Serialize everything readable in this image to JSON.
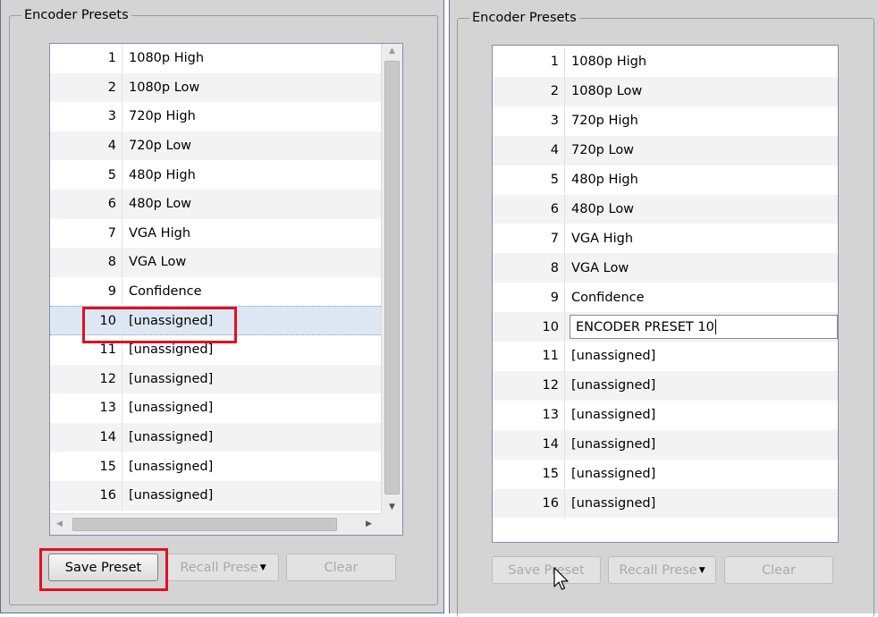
{
  "left": {
    "group_title": "Encoder Presets",
    "rows": [
      {
        "num": "1",
        "name": "1080p High"
      },
      {
        "num": "2",
        "name": "1080p Low"
      },
      {
        "num": "3",
        "name": "720p High"
      },
      {
        "num": "4",
        "name": "720p Low"
      },
      {
        "num": "5",
        "name": "480p High"
      },
      {
        "num": "6",
        "name": "480p Low"
      },
      {
        "num": "7",
        "name": "VGA High"
      },
      {
        "num": "8",
        "name": "VGA Low"
      },
      {
        "num": "9",
        "name": "Confidence"
      },
      {
        "num": "10",
        "name": "[unassigned]"
      },
      {
        "num": "11",
        "name": "[unassigned]"
      },
      {
        "num": "12",
        "name": "[unassigned]"
      },
      {
        "num": "13",
        "name": "[unassigned]"
      },
      {
        "num": "14",
        "name": "[unassigned]"
      },
      {
        "num": "15",
        "name": "[unassigned]"
      },
      {
        "num": "16",
        "name": "[unassigned]"
      }
    ],
    "selected_index": 9,
    "buttons": {
      "save": "Save Preset",
      "recall": "Recall Prese",
      "clear": "Clear"
    }
  },
  "right": {
    "group_title": "Encoder Presets",
    "rows": [
      {
        "num": "1",
        "name": "1080p High"
      },
      {
        "num": "2",
        "name": "1080p Low"
      },
      {
        "num": "3",
        "name": "720p High"
      },
      {
        "num": "4",
        "name": "720p Low"
      },
      {
        "num": "5",
        "name": "480p High"
      },
      {
        "num": "6",
        "name": "480p Low"
      },
      {
        "num": "7",
        "name": "VGA High"
      },
      {
        "num": "8",
        "name": "VGA Low"
      },
      {
        "num": "9",
        "name": "Confidence"
      },
      {
        "num": "10",
        "name": "ENCODER PRESET 10"
      },
      {
        "num": "11",
        "name": "[unassigned]"
      },
      {
        "num": "12",
        "name": "[unassigned]"
      },
      {
        "num": "13",
        "name": "[unassigned]"
      },
      {
        "num": "14",
        "name": "[unassigned]"
      },
      {
        "num": "15",
        "name": "[unassigned]"
      },
      {
        "num": "16",
        "name": "[unassigned]"
      }
    ],
    "editing_index": 9,
    "buttons": {
      "save": "Save Preset",
      "recall": "Recall Prese",
      "clear": "Clear"
    }
  },
  "icons": {
    "dropdown": "triangle-down-icon",
    "scroll_up": "triangle-up-icon",
    "scroll_down": "triangle-down-icon",
    "scroll_left": "triangle-left-icon",
    "scroll_right": "triangle-right-icon",
    "pointer": "mouse-pointer-icon"
  },
  "colors": {
    "annotation": "#e01020",
    "selection": "#dde7f3",
    "panel_bg": "#d4d4d4"
  }
}
